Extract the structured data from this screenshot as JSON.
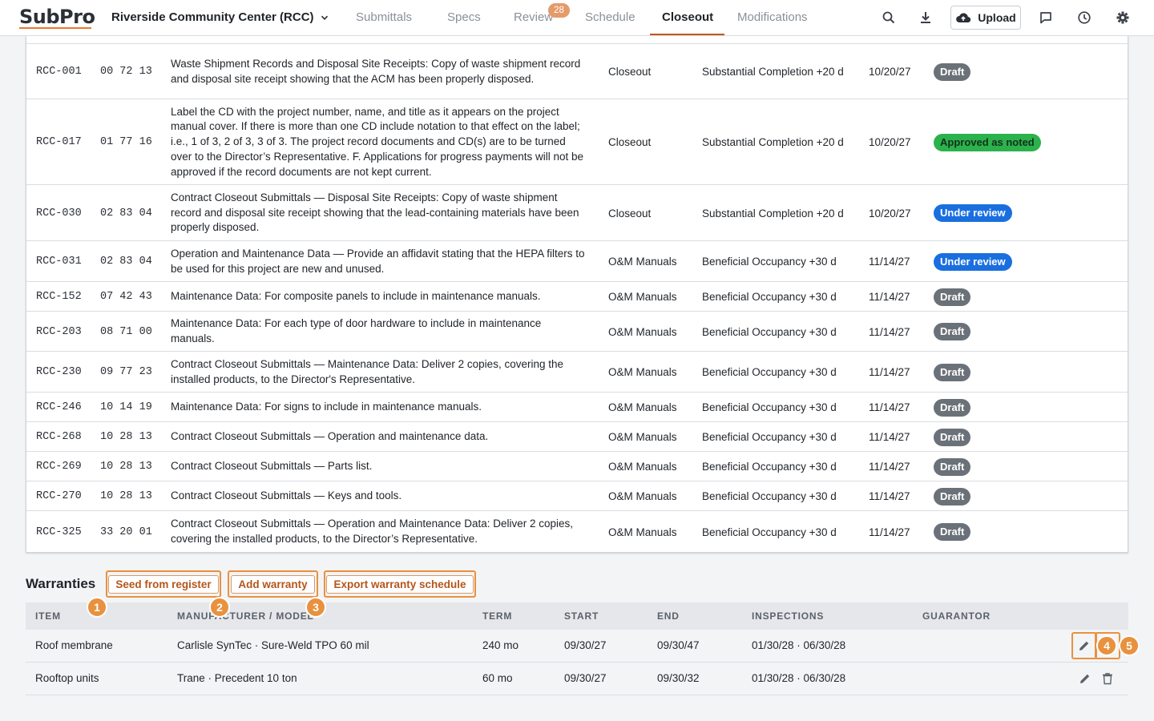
{
  "app": {
    "logo": "SubPro",
    "project": "Riverside Community Center (RCC)"
  },
  "tabs": [
    "Submittals",
    "Specs",
    "Review",
    "Schedule",
    "Closeout",
    "Modifications"
  ],
  "active_tab": "Closeout",
  "review_badge": "28",
  "toolbar": {
    "upload_label": "Upload"
  },
  "submittals": [
    {
      "id": "RCC-001",
      "spec": "00 72 13",
      "desc": "Waste Shipment Records and Disposal Site Receipts: Copy of waste shipment record and disposal site receipt showing that the ACM has been properly disposed.",
      "type": "Closeout",
      "milestone": "Substantial Completion +20 d",
      "date": "10/20/27",
      "status": "Draft",
      "status_kind": "draft"
    },
    {
      "id": "RCC-017",
      "spec": "01 77 16",
      "desc": "Label the CD with the project number, name, and title as it appears on the project manual cover. If there is more than one CD include notation to that effect on the label; i.e., 1 of 3, 2 of 3, 3 of 3. The project record documents and CD(s) are to be turned over to the Director’s Representative. F. Applications for progress payments will not be approved if the record documents are not kept current.",
      "type": "Closeout",
      "milestone": "Substantial Completion +20 d",
      "date": "10/20/27",
      "status": "Approved as noted",
      "status_kind": "approved"
    },
    {
      "id": "RCC-030",
      "spec": "02 83 04",
      "desc": "Contract Closeout Submittals — Disposal Site Receipts: Copy of waste shipment record and disposal site receipt showing that the lead-containing materials have been properly disposed.",
      "type": "Closeout",
      "milestone": "Substantial Completion +20 d",
      "date": "10/20/27",
      "status": "Under review",
      "status_kind": "review"
    },
    {
      "id": "RCC-031",
      "spec": "02 83 04",
      "desc": "Operation and Maintenance Data — Provide an affidavit stating that the HEPA filters to be used for this project are new and unused.",
      "type": "O&M Manuals",
      "milestone": "Beneficial Occupancy +30 d",
      "date": "11/14/27",
      "status": "Under review",
      "status_kind": "review"
    },
    {
      "id": "RCC-152",
      "spec": "07 42 43",
      "desc": "Maintenance Data: For composite panels to include in maintenance manuals.",
      "type": "O&M Manuals",
      "milestone": "Beneficial Occupancy +30 d",
      "date": "11/14/27",
      "status": "Draft",
      "status_kind": "draft"
    },
    {
      "id": "RCC-203",
      "spec": "08 71 00",
      "desc": "Maintenance Data: For each type of door hardware to include in maintenance manuals.",
      "type": "O&M Manuals",
      "milestone": "Beneficial Occupancy +30 d",
      "date": "11/14/27",
      "status": "Draft",
      "status_kind": "draft"
    },
    {
      "id": "RCC-230",
      "spec": "09 77 23",
      "desc": "Contract Closeout Submittals — Maintenance Data: Deliver 2 copies, covering the installed products, to the Director's Representative.",
      "type": "O&M Manuals",
      "milestone": "Beneficial Occupancy +30 d",
      "date": "11/14/27",
      "status": "Draft",
      "status_kind": "draft"
    },
    {
      "id": "RCC-246",
      "spec": "10 14 19",
      "desc": "Maintenance Data: For signs to include in maintenance manuals.",
      "type": "O&M Manuals",
      "milestone": "Beneficial Occupancy +30 d",
      "date": "11/14/27",
      "status": "Draft",
      "status_kind": "draft"
    },
    {
      "id": "RCC-268",
      "spec": "10 28 13",
      "desc": "Contract Closeout Submittals — Operation and maintenance data.",
      "type": "O&M Manuals",
      "milestone": "Beneficial Occupancy +30 d",
      "date": "11/14/27",
      "status": "Draft",
      "status_kind": "draft"
    },
    {
      "id": "RCC-269",
      "spec": "10 28 13",
      "desc": "Contract Closeout Submittals — Parts list.",
      "type": "O&M Manuals",
      "milestone": "Beneficial Occupancy +30 d",
      "date": "11/14/27",
      "status": "Draft",
      "status_kind": "draft"
    },
    {
      "id": "RCC-270",
      "spec": "10 28 13",
      "desc": "Contract Closeout Submittals — Keys and tools.",
      "type": "O&M Manuals",
      "milestone": "Beneficial Occupancy +30 d",
      "date": "11/14/27",
      "status": "Draft",
      "status_kind": "draft"
    },
    {
      "id": "RCC-325",
      "spec": "33 20 01",
      "desc": "Contract Closeout Submittals — Operation and Maintenance Data: Deliver 2 copies, covering the installed products, to the Director’s Representative.",
      "type": "O&M Manuals",
      "milestone": "Beneficial Occupancy +30 d",
      "date": "11/14/27",
      "status": "Draft",
      "status_kind": "draft"
    }
  ],
  "warranties": {
    "title": "Warranties",
    "buttons": {
      "seed": "Seed from register",
      "add": "Add warranty",
      "export": "Export warranty schedule"
    },
    "markers": [
      "1",
      "2",
      "3",
      "4",
      "5"
    ],
    "columns": [
      "ITEM",
      "MANUFACTURER / MODEL",
      "TERM",
      "START",
      "END",
      "INSPECTIONS",
      "GUARANTOR"
    ],
    "rows": [
      {
        "item": "Roof membrane",
        "manufacturer": "Carlisle SynTec · Sure-Weld TPO 60 mil",
        "term": "240 mo",
        "start": "09/30/27",
        "end": "09/30/47",
        "inspections": "01/30/28 · 06/30/28",
        "guarantor": ""
      },
      {
        "item": "Rooftop units",
        "manufacturer": "Trane · Precedent 10 ton",
        "term": "60 mo",
        "start": "09/30/27",
        "end": "09/30/32",
        "inspections": "01/30/28 · 06/30/28",
        "guarantor": ""
      }
    ]
  },
  "colors": {
    "accent": "#c2571a",
    "marker": "#e8913e",
    "draft": "#6b7178",
    "review": "#1a6fdf",
    "approved": "#2bb24c"
  },
  "icons": [
    "search-icon",
    "download-icon",
    "cloud-upload-icon",
    "comment-icon",
    "history-icon",
    "gear-icon",
    "chevron-down-icon",
    "pencil-icon",
    "trash-icon"
  ]
}
